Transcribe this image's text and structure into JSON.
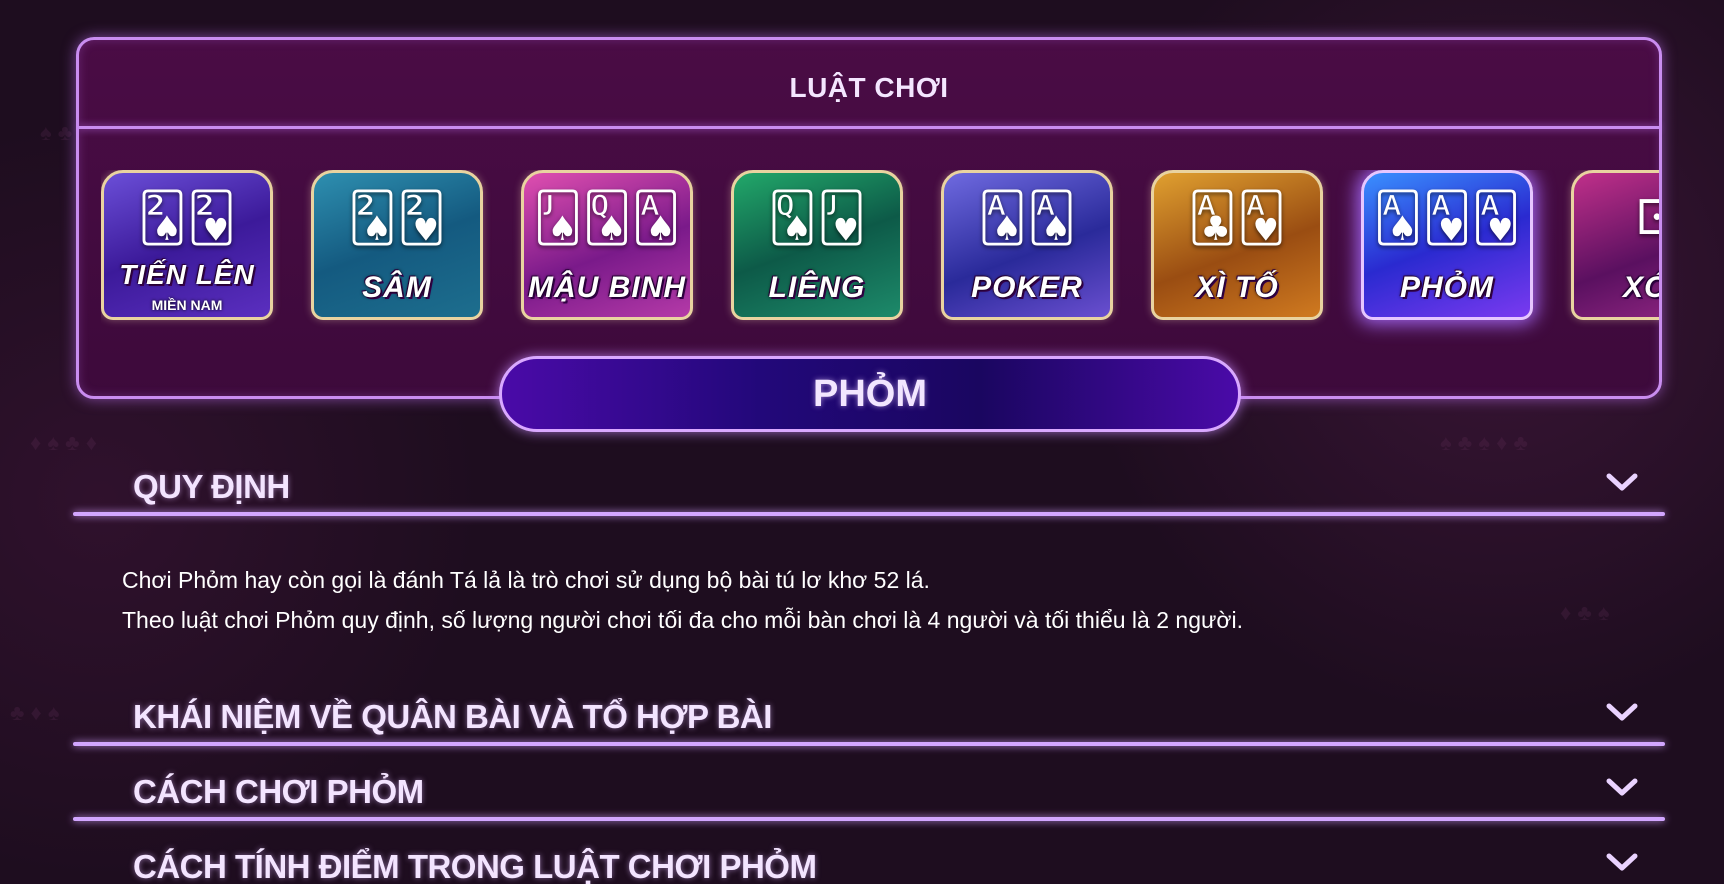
{
  "rules": {
    "title": "LUẬT CHƠI"
  },
  "games": [
    {
      "label": "TIẾN LÊN",
      "sub": "MIỀN NAM",
      "icon": "cards-icon"
    },
    {
      "label": "SÂM",
      "sub": "",
      "icon": "cards-icon"
    },
    {
      "label": "MẬU BINH",
      "sub": "",
      "icon": "cards-icon"
    },
    {
      "label": "LIÊNG",
      "sub": "",
      "icon": "cards-icon"
    },
    {
      "label": "POKER",
      "sub": "",
      "icon": "cards-icon"
    },
    {
      "label": "XÌ TỐ",
      "sub": "",
      "icon": "cards-icon"
    },
    {
      "label": "PHỎM",
      "sub": "",
      "icon": "cards-icon"
    },
    {
      "label": "XÓC",
      "sub": "",
      "icon": "dice-icon"
    }
  ],
  "selected_game": "PHỎM",
  "accordion": [
    {
      "title": "QUY ĐỊNH",
      "expanded": true,
      "body": [
        "Chơi Phỏm hay còn gọi là đánh Tá lả là trò chơi sử dụng bộ bài tú lơ khơ 52 lá.",
        "Theo luật chơi Phỏm quy định, số lượng người chơi tối đa cho mỗi bàn chơi là 4 người và tối thiểu là 2 người."
      ]
    },
    {
      "title": "KHÁI NIỆM VỀ QUÂN BÀI VÀ TỔ HỢP BÀI",
      "expanded": false
    },
    {
      "title": "CÁCH CHƠI PHỎM",
      "expanded": false
    },
    {
      "title": "CÁCH TÍNH ĐIỂM TRONG LUẬT CHƠI PHỎM",
      "expanded": false
    }
  ],
  "colors": {
    "background": "#1e0d1f",
    "panel": "#4a0c45",
    "accent_border": "#c98df0",
    "pill": "#22087a"
  }
}
